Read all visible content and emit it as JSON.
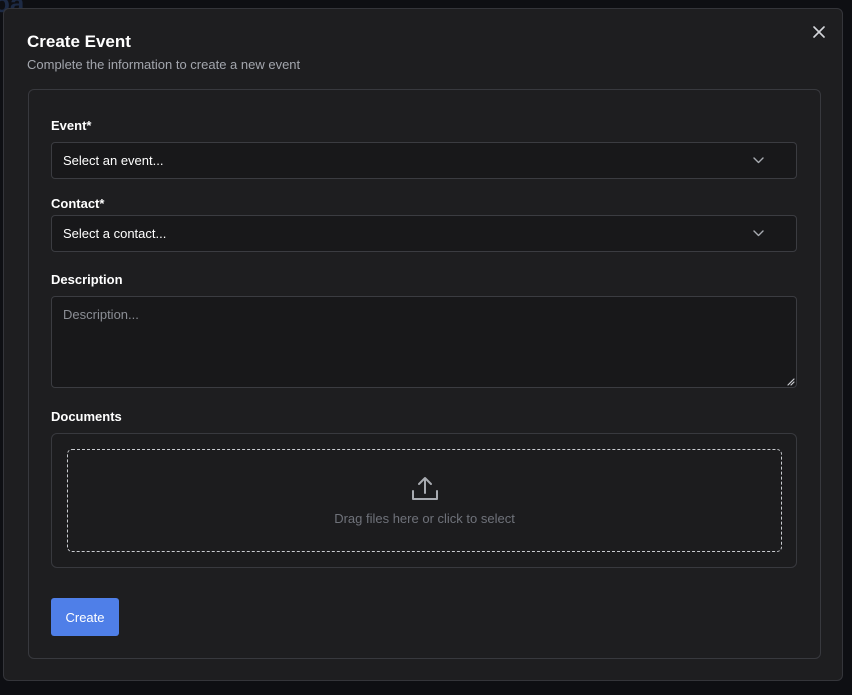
{
  "modal": {
    "title": "Create Event",
    "subtitle": "Complete the information to create a new event",
    "close_icon": "close-icon"
  },
  "form": {
    "event": {
      "label": "Event*",
      "value": "Select an event...",
      "icon": "chevron-down-icon"
    },
    "contact": {
      "label": "Contact*",
      "value": "Select a contact...",
      "icon": "chevron-down-icon"
    },
    "description": {
      "label": "Description",
      "placeholder": "Description...",
      "value": ""
    },
    "documents": {
      "label": "Documents",
      "dropzone_text": "Drag files here or click to select",
      "icon": "upload-icon"
    },
    "submit_label": "Create"
  },
  "colors": {
    "modal_bg": "#1e1e20",
    "input_bg": "#18181a",
    "border": "#38393e",
    "accent": "#4f7fe8",
    "muted_text": "#a3a6ad"
  }
}
